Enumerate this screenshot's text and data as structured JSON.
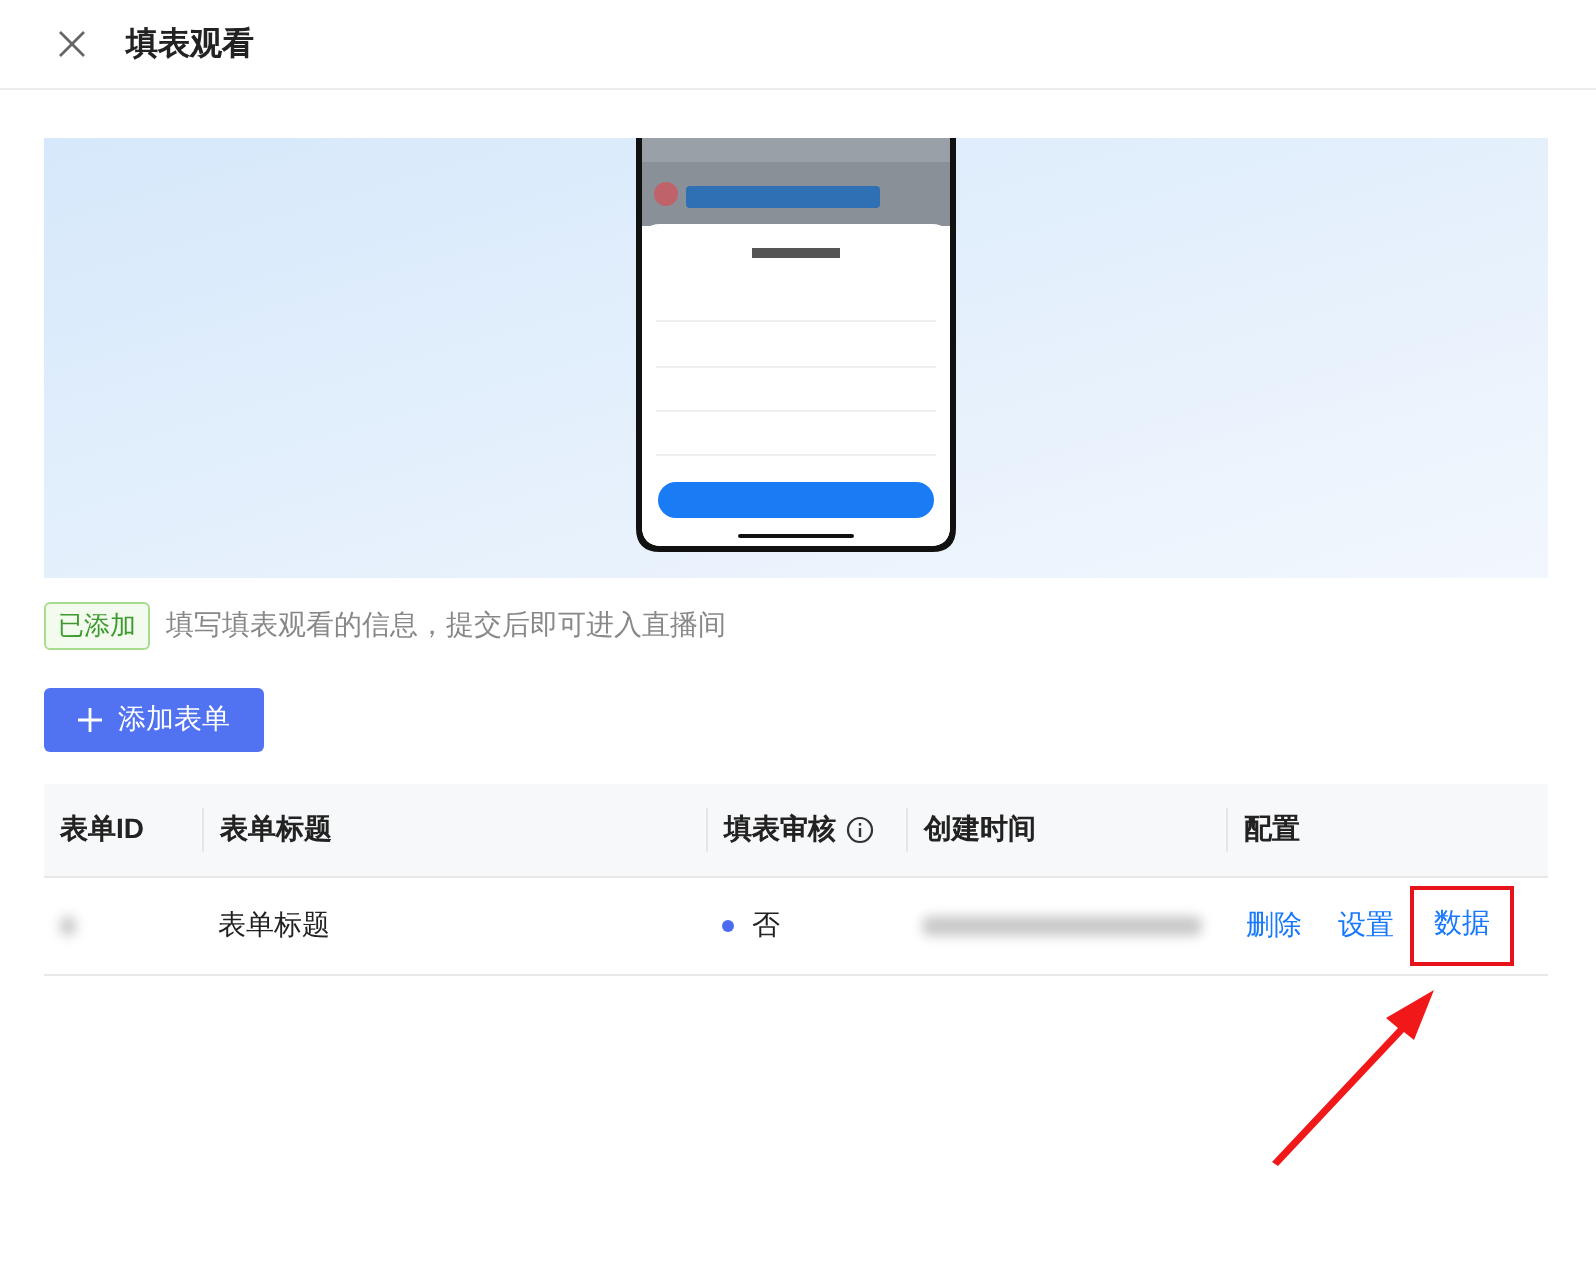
{
  "header": {
    "title": "填表观看"
  },
  "status": {
    "tag": "已添加",
    "description": "填写填表观看的信息，提交后即可进入直播间"
  },
  "add_button": {
    "label": "添加表单"
  },
  "table": {
    "columns": [
      {
        "label": "表单ID",
        "info": false
      },
      {
        "label": "表单标题",
        "info": false
      },
      {
        "label": "填表审核",
        "info": true
      },
      {
        "label": "创建时间",
        "info": false
      },
      {
        "label": "配置",
        "info": false
      }
    ],
    "rows": [
      {
        "id_blurred": true,
        "title": "表单标题",
        "review": "否",
        "time_blurred": true,
        "actions": [
          {
            "label": "删除",
            "highlighted": false
          },
          {
            "label": "设置",
            "highlighted": false
          },
          {
            "label": "数据",
            "highlighted": true
          }
        ]
      }
    ]
  },
  "annotation": {
    "arrow": true
  }
}
